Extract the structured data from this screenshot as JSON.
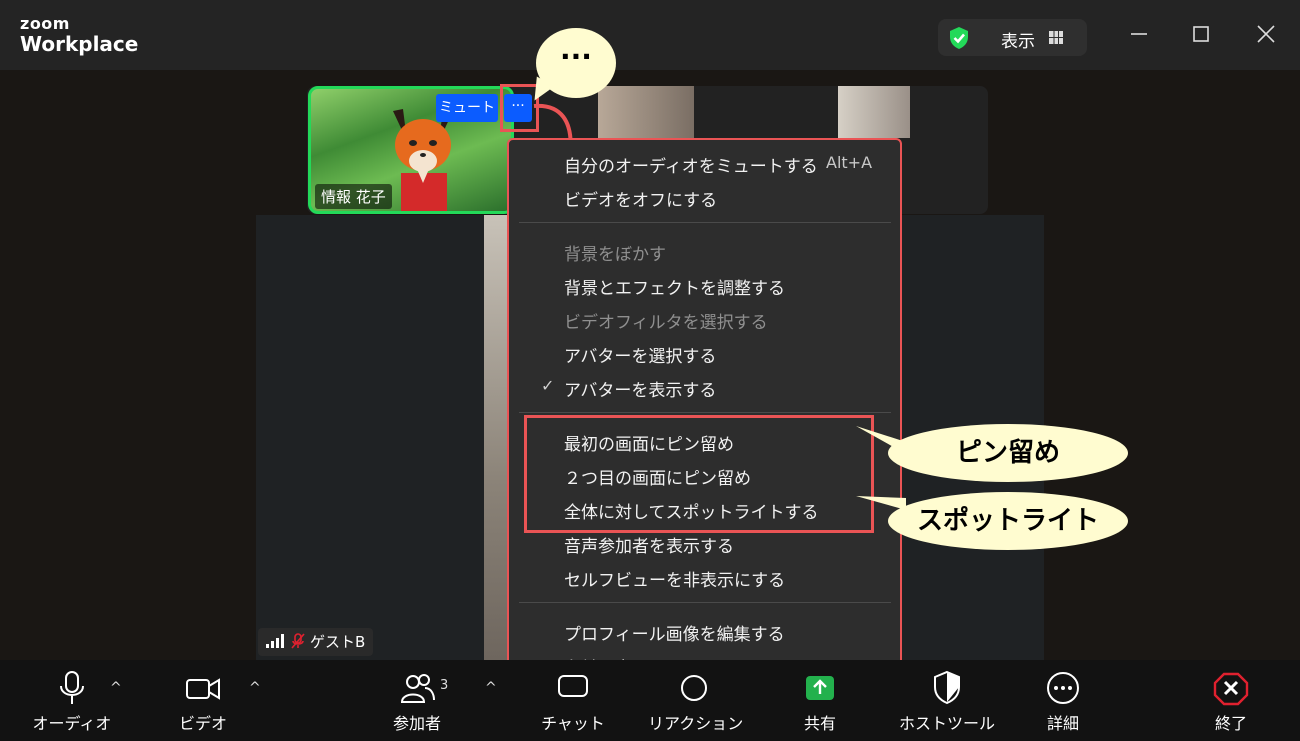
{
  "app": {
    "brand_top": "zoom",
    "brand_bottom": "Workplace"
  },
  "titlebar": {
    "view_label": "表示",
    "shield_color": "#23d959"
  },
  "video": {
    "self_name": "情報 花子",
    "mute_label": "ミュート",
    "more_label": "···",
    "callout_dots": "···",
    "guest_name": "ゲストB",
    "active_border_color": "#23d959"
  },
  "menu": {
    "items": [
      {
        "label": "自分のオーディオをミュートする",
        "shortcut": "Alt+A",
        "disabled": false
      },
      {
        "label": "ビデオをオフにする",
        "disabled": false
      },
      {
        "label": "背景をぼかす",
        "disabled": true
      },
      {
        "label": "背景とエフェクトを調整する",
        "disabled": false
      },
      {
        "label": "ビデオフィルタを選択する",
        "disabled": true
      },
      {
        "label": "アバターを選択する",
        "disabled": false
      },
      {
        "label": "アバターを表示する",
        "disabled": false,
        "checked": true,
        "check": "✓"
      },
      {
        "label": "最初の画面にピン留め",
        "disabled": false
      },
      {
        "label": "２つ目の画面にピン留め",
        "disabled": false
      },
      {
        "label": "全体に対してスポットライトする",
        "disabled": false
      },
      {
        "label": "音声参加者を表示する",
        "disabled": false
      },
      {
        "label": "セルフビューを非表示にする",
        "disabled": false
      },
      {
        "label": "プロフィール画像を編集する",
        "disabled": false
      },
      {
        "label": "名前を変更する",
        "disabled": false
      }
    ]
  },
  "callouts": {
    "pin": "ピン留め",
    "spotlight": "スポットライト",
    "highlight_color": "#ea5455"
  },
  "toolbar": {
    "audio": "オーディオ",
    "video": "ビデオ",
    "participants": "参加者",
    "participants_count": "3",
    "chat": "チャット",
    "reactions": "リアクション",
    "share": "共有",
    "host_tools": "ホストツール",
    "more": "詳細",
    "end": "終了",
    "caret": "^",
    "end_color": "#e0212f",
    "share_color": "#23b14d"
  }
}
